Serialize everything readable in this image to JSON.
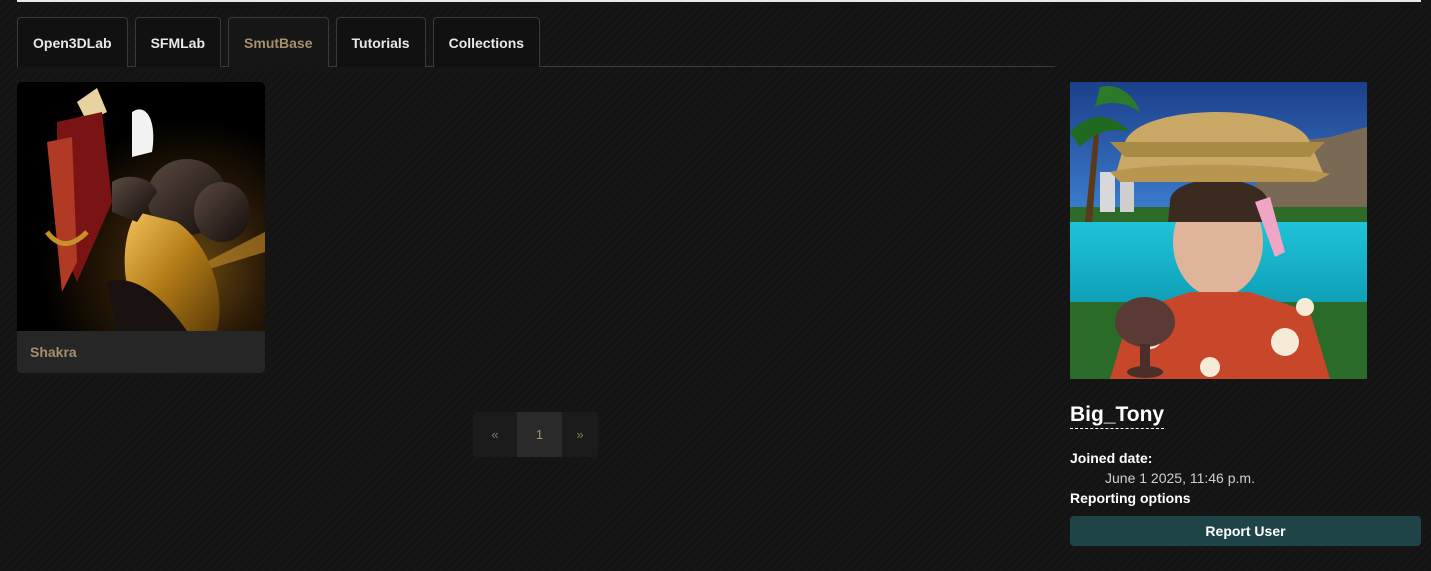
{
  "nav": {
    "tabs": [
      {
        "label": "Open3DLab",
        "active": false
      },
      {
        "label": "SFMLab",
        "active": false
      },
      {
        "label": "SmutBase",
        "active": true
      },
      {
        "label": "Tutorials",
        "active": false
      },
      {
        "label": "Collections",
        "active": false
      }
    ]
  },
  "gallery": {
    "items": [
      {
        "title": "Shakra"
      }
    ]
  },
  "pagination": {
    "prev": "«",
    "current": "1",
    "next": "»"
  },
  "profile": {
    "username": "Big_Tony",
    "joined_label": "Joined date:",
    "joined_value": "June 1 2025, 11:46 p.m.",
    "reporting_label": "Reporting options",
    "report_button": "Report User"
  },
  "colors": {
    "accent": "#a68f6a",
    "report_button_bg": "#1f4448",
    "background": "#141414"
  }
}
